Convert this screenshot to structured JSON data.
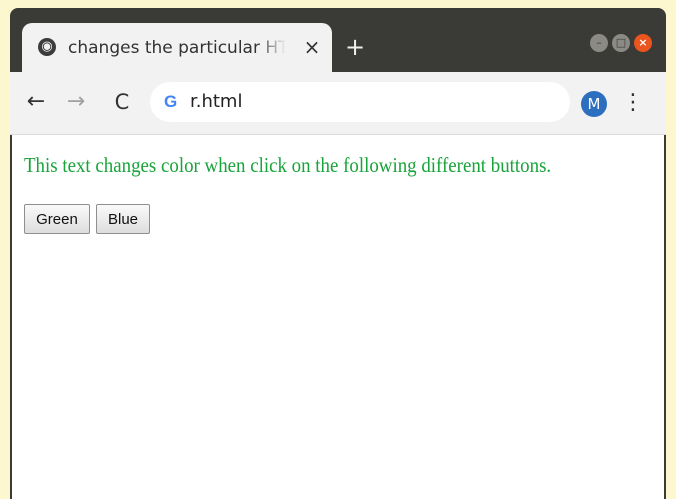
{
  "browser": {
    "tab": {
      "title": "changes the particular HTML element color",
      "close_glyph": "×",
      "favicon": "globe-icon"
    },
    "new_tab_glyph": "+",
    "window_controls": {
      "minimize": "–",
      "maximize": "□",
      "close": "×"
    },
    "toolbar": {
      "back_glyph": "←",
      "forward_glyph": "→",
      "reload_glyph": "C",
      "url": "r.html",
      "search_engine_icon": "google-g-icon",
      "avatar_initial": "M",
      "menu_glyph": "⋮"
    }
  },
  "page": {
    "paragraph": "This text changes color when click on the following different buttons.",
    "paragraph_color": "#18a43a",
    "buttons": [
      {
        "label": "Green"
      },
      {
        "label": "Blue"
      }
    ]
  },
  "colors": {
    "background": "#fdf7cf",
    "titlebar": "#3a3a36",
    "close_button": "#e9541f",
    "avatar": "#2d6fbe"
  }
}
